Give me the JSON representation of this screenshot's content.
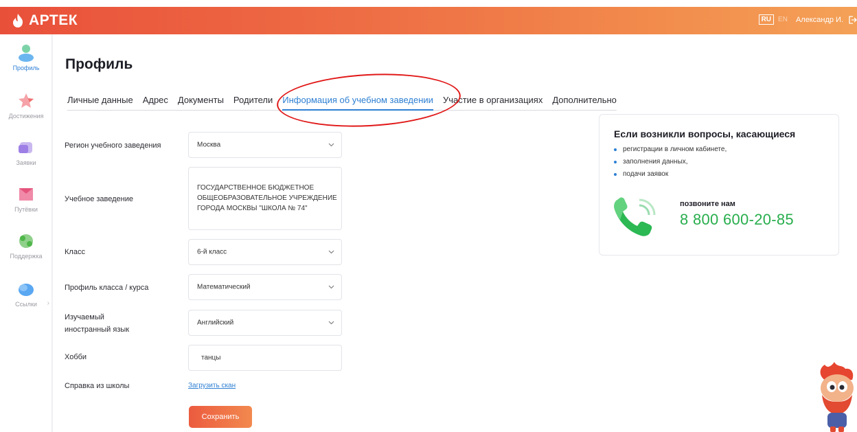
{
  "header": {
    "logo_text": "АРТЕК",
    "lang_active": "RU",
    "lang_other": "EN",
    "user_name": "Александр И."
  },
  "sidebar": {
    "items": [
      {
        "label": "Профиль",
        "icon": "profile-icon",
        "active": true
      },
      {
        "label": "Достижения",
        "icon": "star-icon",
        "active": false
      },
      {
        "label": "Заявки",
        "icon": "folder-icon",
        "active": false
      },
      {
        "label": "Путёвки",
        "icon": "ticket-icon",
        "active": false
      },
      {
        "label": "Поддержка",
        "icon": "support-icon",
        "active": false
      },
      {
        "label": "Ссылки",
        "icon": "chat-icon",
        "active": false
      }
    ]
  },
  "page": {
    "title": "Профиль"
  },
  "tabs": [
    {
      "label": "Личные данные",
      "active": false
    },
    {
      "label": "Адрес",
      "active": false
    },
    {
      "label": "Документы",
      "active": false
    },
    {
      "label": "Родители",
      "active": false
    },
    {
      "label": "Информация об учебном заведении",
      "active": true
    },
    {
      "label": "Участие в организациях",
      "active": false
    },
    {
      "label": "Дополнительно",
      "active": false
    }
  ],
  "form": {
    "region_label": "Регион учебного заведения",
    "region_value": "Москва",
    "school_label": "Учебное заведение",
    "school_value": "ГОСУДАРСТВЕННОЕ БЮДЖЕТНОЕ ОБЩЕОБРАЗОВАТЕЛЬНОЕ УЧРЕЖДЕНИЕ ГОРОДА МОСКВЫ \"ШКОЛА № 74\"",
    "class_label": "Класс",
    "class_value": "6-й класс",
    "profile_label": "Профиль класса / курса",
    "profile_value": "Математический",
    "language_label_1": "Изучаемый",
    "language_label_2": "иностранный язык",
    "language_value": "Английский",
    "hobby_label": "Хобби",
    "hobby_value": "танцы",
    "certificate_label": "Справка из школы",
    "upload_link": "Загрузить скан",
    "save_button": "Сохранить"
  },
  "help": {
    "title": "Если возникли вопросы, касающиеся",
    "items": [
      "регистрации в личном кабинете,",
      "заполнения данных,",
      "подачи заявок"
    ],
    "call_label": "позвоните нам",
    "phone": "8 800 600-20-85"
  },
  "colors": {
    "brand_orange": "#ee6f45",
    "accent_blue": "#2d7fd3",
    "phone_green": "#27ad4c",
    "annotation_red": "#e11818"
  }
}
